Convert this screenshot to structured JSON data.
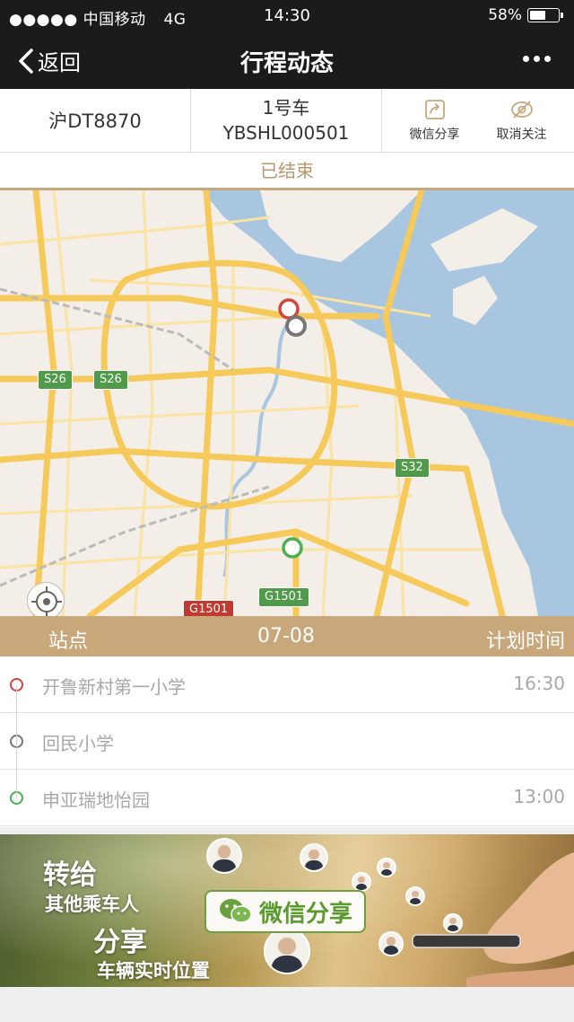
{
  "status_bar": {
    "carrier": "●●●●● 中国移动",
    "network": "4G",
    "time": "14:30",
    "battery": "58%",
    "battery_level": 0.58
  },
  "nav": {
    "back_label": "返回",
    "title": "行程动态",
    "more_icon": "more-dots-icon"
  },
  "vehicle": {
    "plate": "沪DT8870",
    "car_name": "1号车",
    "car_code": "YBSHL000501",
    "wechat_share_label": "微信分享",
    "unfollow_label": "取消关注"
  },
  "trip_status": "已结束",
  "map": {
    "road_labels": [
      "S26",
      "S26",
      "S32",
      "G1501",
      "G1501"
    ],
    "colors": {
      "road": "#f6c95b",
      "water": "#a8c6e0",
      "land": "#f3eee7"
    }
  },
  "table": {
    "col_station": "站点",
    "col_date": "07-08",
    "col_time": "计划时间"
  },
  "stops": [
    {
      "name": "开鲁新村第一小学",
      "time": "16:30",
      "color": "#d0453d"
    },
    {
      "name": "回民小学",
      "time": "",
      "color": "#777777"
    },
    {
      "name": "申亚瑞地怡园",
      "time": "13:00",
      "color": "#4caf50"
    }
  ],
  "banner": {
    "line1": "转给",
    "line2": "其他乘车人",
    "line3": "分享",
    "line4": "车辆实时位置",
    "button": "微信分享"
  }
}
